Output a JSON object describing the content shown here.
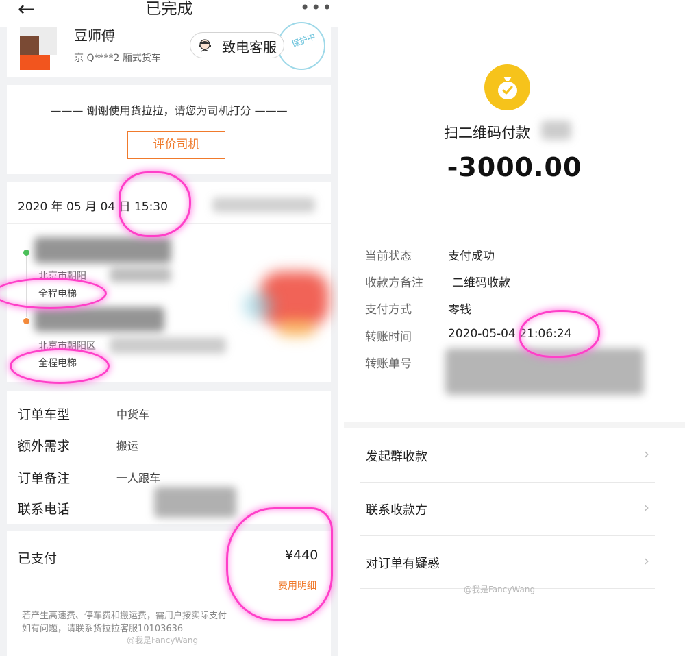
{
  "left": {
    "topbar": {
      "back_icon": "arrow-left-icon",
      "title": "已完成",
      "more_label": "•••"
    },
    "driver": {
      "name": "豆师傅",
      "plate": "京 Q****2 厢式货车",
      "call_label": "致电客服",
      "protect_label": "保护中"
    },
    "rating": {
      "message": "——— 谢谢使用货拉拉，请您为司机打分 ———",
      "button_label": "评价司机"
    },
    "order": {
      "datetime": "2020 年 05 月 04 日 15:30",
      "start_addr": "北京市朝阳",
      "start_tag": "全程电梯",
      "end_addr": "北京市朝阳区",
      "end_tag": "全程电梯"
    },
    "info": [
      {
        "label": "订单车型",
        "value": "中货车"
      },
      {
        "label": "额外需求",
        "value": "搬运"
      },
      {
        "label": "订单备注",
        "value": "一人跟车"
      },
      {
        "label": "联系电话",
        "value": ""
      }
    ],
    "payment": {
      "paid_label": "已支付",
      "amount": "¥440",
      "fee_detail_label": "费用明细",
      "note_line1": "若产生高速费、停车费和搬运费，需用户按实际支付",
      "note_line2": "如有问题，请联系货拉拉客服10103636"
    },
    "watermark": "@我是FancyWang"
  },
  "right": {
    "icon": "money-bag-icon",
    "title": "扫二维码付款",
    "amount": "-3000.00",
    "details": [
      {
        "label": "当前状态",
        "value": "支付成功"
      },
      {
        "label": "收款方备注",
        "value": "二维码收款"
      },
      {
        "label": "支付方式",
        "value": "零钱"
      },
      {
        "label": "转账时间",
        "value": "2020-05-04 21:06:24"
      },
      {
        "label": "转账单号",
        "value": ""
      }
    ],
    "actions": [
      {
        "label": "发起群收款"
      },
      {
        "label": "联系收款方"
      },
      {
        "label": "对订单有疑惑"
      }
    ],
    "watermark": "@我是FancyWang"
  },
  "colors": {
    "accent_orange": "#ef7a2c",
    "highlight_pink": "#ff3fc8",
    "wechat_yellow": "#f6c31b"
  }
}
